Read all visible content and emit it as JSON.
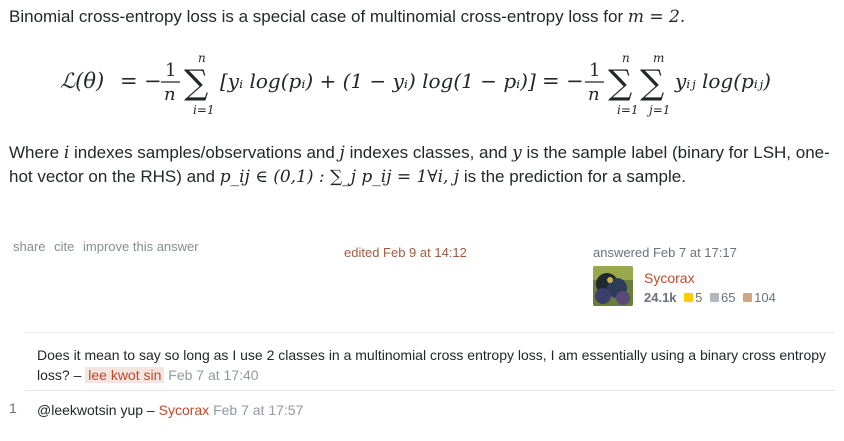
{
  "answer": {
    "intro_text": "Binomial cross-entropy loss is a special case of multinomial cross-entropy loss for",
    "intro_math": "m = 2.",
    "where_parts": [
      "Where",
      "i",
      "indexes samples/observations and",
      "j",
      "indexes classes, and",
      "y",
      "is the sample label (binary for LSH, one-hot vector on the RHS) and",
      "p_ij ∈ (0,1) : ∑_j p_ij = 1∀i, j",
      "is the prediction for a sample."
    ]
  },
  "equation": {
    "lhs": "ℒ(θ)",
    "eq": "=",
    "minus": "−",
    "frac_num": "1",
    "frac_den": "n",
    "sum_top_n": "n",
    "sum_top_m": "m",
    "sum_bottom_i": "i=1",
    "sum_bottom_j": "j=1",
    "sigma": "∑",
    "middle_term": "[yᵢ log(pᵢ) + (1 − yᵢ) log(1 − pᵢ)]",
    "right_term": "yᵢⱼ log(pᵢⱼ)"
  },
  "post_menu": {
    "share": "share",
    "cite": "cite",
    "improve": "improve this answer"
  },
  "edited": "edited Feb 9 at 14:12",
  "answered": "answered Feb 7 at 17:17",
  "user": {
    "name": "Sycorax",
    "reputation": "24.1k",
    "gold": "5",
    "silver": "65",
    "bronze": "104",
    "colors": {
      "gold": "#ffcc01",
      "silver": "#b4b8bc",
      "bronze": "#d1a684"
    }
  },
  "comments": [
    {
      "score": "",
      "text": "Does it mean to say so long as I use 2 classes in a multinomial cross entropy loss, I am essentially using a binary cross entropy loss? –",
      "user": "lee kwot sin",
      "date": "Feb 7 at 17:40"
    },
    {
      "score": "1",
      "text": "@leekwotsin yup –",
      "user": "Sycorax",
      "date": "Feb 7 at 17:57"
    }
  ]
}
